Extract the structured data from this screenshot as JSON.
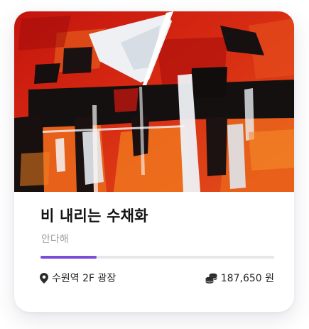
{
  "card": {
    "title": "비 내리는 수채화",
    "artist": "안다해",
    "progress": 0.24,
    "location": "수원역 2F 광장",
    "price": "187,650 원"
  },
  "colors": {
    "accent": "#7b4ddb",
    "track": "#e7e7ea",
    "title": "#141414",
    "subtitle": "#a3a3a3"
  },
  "icons": {
    "location": "map-pin-icon",
    "price": "coins-icon"
  }
}
